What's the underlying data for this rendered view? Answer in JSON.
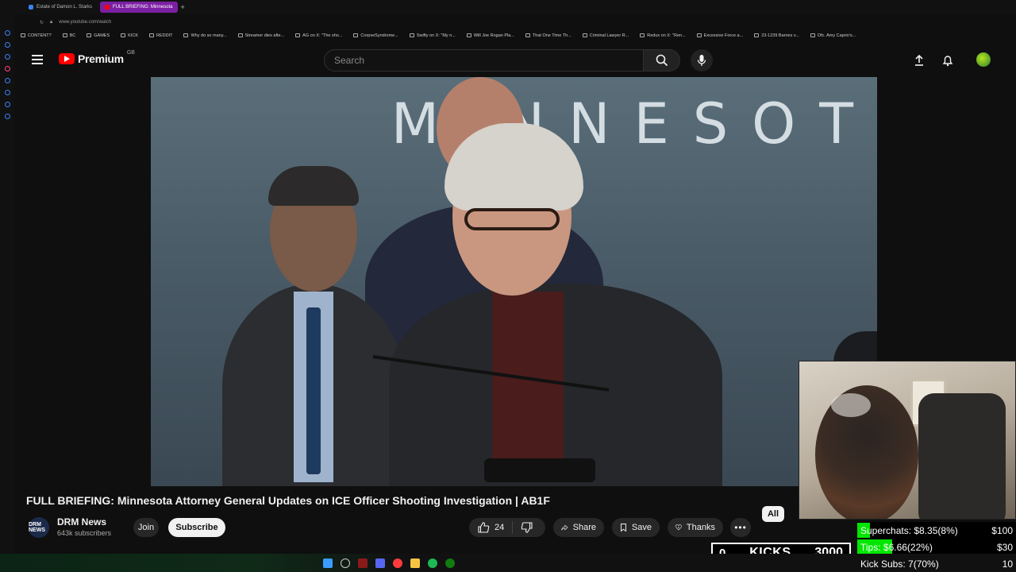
{
  "browser": {
    "tabs": [
      {
        "label": "Estate of Damon L. Starks"
      },
      {
        "label": "FULL BRIEFING: Minnesota"
      }
    ],
    "url": "www.youtube.com/watch",
    "bookmarks": [
      "CONTENT?",
      "BC",
      "GAMES",
      "KICK",
      "REDDIT",
      "Why do so many...",
      "Streamer dies afte...",
      "AG on X: \"The sho...",
      "CorpseSyndrome...",
      "Swifty on X: \"My n...",
      "Will Joe Rogan Pla...",
      "That One Time Th...",
      "Criminal Lawyer R...",
      "Redux on X: \"Ren...",
      "Excessive Force a...",
      "23-1239 Barnes v...",
      "Ofc. Amy Caprio's..."
    ]
  },
  "header": {
    "logo_text": "Premium",
    "country": "GB",
    "search_placeholder": "Search"
  },
  "video": {
    "sign_text": "MINNESOT",
    "title": "FULL BRIEFING: Minnesota Attorney General Updates on ICE Officer Shooting Investigation | AB1F"
  },
  "channel": {
    "avatar_text": "DRM NEWS",
    "name": "DRM News",
    "subscribers": "643k subscribers",
    "join_label": "Join",
    "subscribe_label": "Subscribe"
  },
  "actions": {
    "like_count": "24",
    "share_label": "Share",
    "save_label": "Save",
    "thanks_label": "Thanks",
    "more_label": "•••",
    "all_chip": "All"
  },
  "overlay": {
    "kicks_current": "0",
    "kicks_label": "KICKS",
    "kicks_goal": "3000",
    "goals": [
      {
        "text": "Superchats: $8.35(8%)",
        "max": "$100",
        "progress": 0.08
      },
      {
        "text": "Tips: $6.66(22%)",
        "max": "$30",
        "progress": 0.22
      },
      {
        "text": "Kick Subs: 7(70%)",
        "max": "10",
        "progress": 0.7
      }
    ]
  },
  "colors": {
    "youtube_red": "#ff0000",
    "goal_fill": "#00e600",
    "active_tab": "#7b1fa2"
  }
}
